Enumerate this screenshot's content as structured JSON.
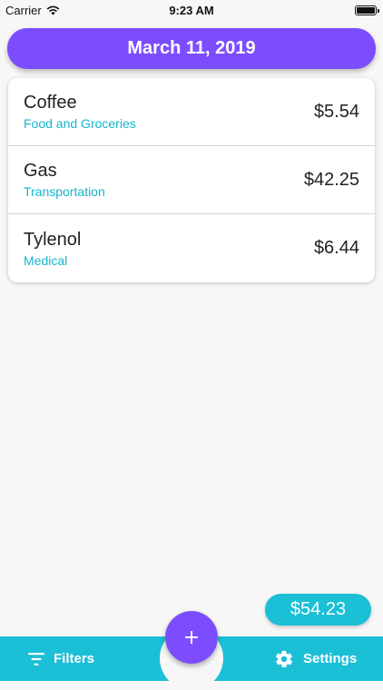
{
  "status_bar": {
    "carrier": "Carrier",
    "time": "9:23 AM"
  },
  "header": {
    "date": "March 11, 2019"
  },
  "expenses": [
    {
      "name": "Coffee",
      "category": "Food and Groceries",
      "amount": "$5.54"
    },
    {
      "name": "Gas",
      "category": "Transportation",
      "amount": "$42.25"
    },
    {
      "name": "Tylenol",
      "category": "Medical",
      "amount": "$6.44"
    }
  ],
  "total": "$54.23",
  "bottom_bar": {
    "filters_label": "Filters",
    "settings_label": "Settings",
    "add_icon": "plus-icon",
    "filters_icon": "filter-icon",
    "settings_icon": "gear-icon"
  },
  "colors": {
    "accent_purple": "#7c4dff",
    "accent_cyan": "#1bbfd6",
    "category_text": "#16b5cf",
    "background": "#f7f7f7"
  }
}
